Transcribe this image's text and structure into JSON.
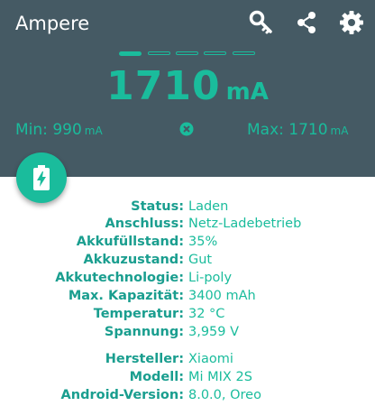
{
  "app": {
    "title": "Ampere"
  },
  "toolbar": {
    "icons": [
      "key-icon",
      "share-icon",
      "gear-icon"
    ]
  },
  "pager": {
    "page_count": 5,
    "active_index": 0
  },
  "current": {
    "value": "1710",
    "unit": "mA"
  },
  "min": {
    "label": "Min:",
    "value": "990",
    "unit": "mA"
  },
  "max": {
    "label": "Max:",
    "value": "1710",
    "unit": "mA"
  },
  "colors": {
    "header": "#455a64",
    "accent": "#1abc9c",
    "text": "#26a69a"
  },
  "info_rows": [
    {
      "key": "Status:",
      "value": "Laden"
    },
    {
      "key": "Anschluss:",
      "value": "Netz-Ladebetrieb"
    },
    {
      "key": "Akkufüllstand:",
      "value": "35%"
    },
    {
      "key": "Akkuzustand:",
      "value": "Gut"
    },
    {
      "key": "Akkutechnologie:",
      "value": "Li-poly"
    },
    {
      "key": "Max. Kapazität:",
      "value": "3400 mAh"
    },
    {
      "key": "Temperatur:",
      "value": "32 °C"
    },
    {
      "key": "Spannung:",
      "value": "3,959 V"
    },
    {
      "key": "Hersteller:",
      "value": "Xiaomi"
    },
    {
      "key": "Modell:",
      "value": "Mi MIX 2S"
    },
    {
      "key": "Android-Version:",
      "value": "8.0.0, Oreo"
    }
  ]
}
